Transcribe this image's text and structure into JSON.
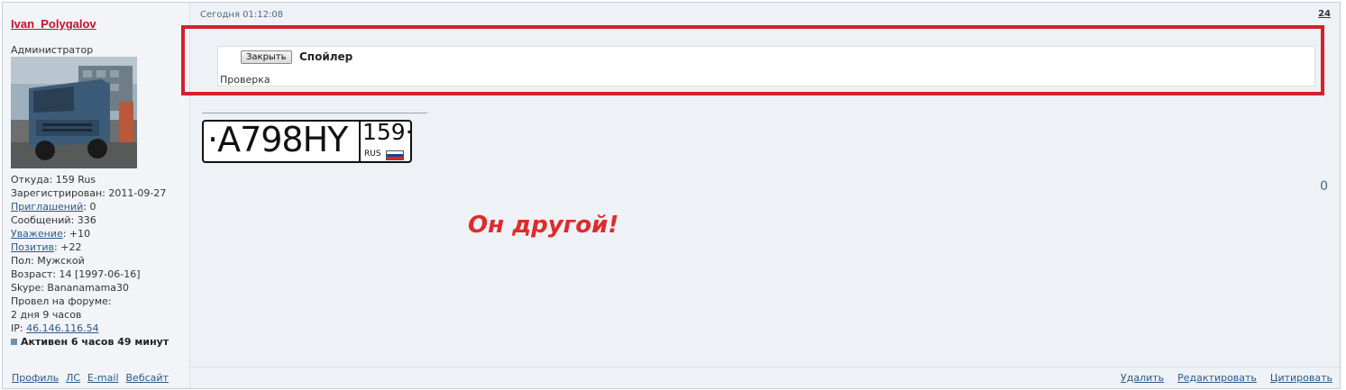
{
  "author": {
    "name": "Ivan_Polygalov",
    "rank": "Администратор",
    "profile": {
      "from": "Откуда: 159 Rus",
      "registered": "Зарегистрирован: 2011-09-27",
      "invites_label": "Приглашений",
      "invites_value": ": 0",
      "messages": "Сообщений: 336",
      "respect_label": "Уважение",
      "respect_value": ": +10",
      "positive_label": "Позитив",
      "positive_value": ": +22",
      "gender": "Пол: Мужской",
      "age": "Возраст: 14 [1997-06-16]",
      "skype": "Skype: Bananamama30",
      "forum_time_label": "Провел на форуме:",
      "forum_time_value": "2 дня 9 часов",
      "ip_label": "IP: ",
      "ip_value": "46.146.116.54",
      "online": "Активен 6 часов 49 минут"
    },
    "links": [
      "Профиль",
      "ЛС",
      "E-mail",
      "Вебсайт"
    ]
  },
  "post": {
    "date": "Сегодня 01:12:08",
    "number": "24",
    "spoiler": {
      "button_label": "Закрыть",
      "title": "Спойлер",
      "body": "Проверка"
    },
    "plate": {
      "main": "·A798HY",
      "region": "159·",
      "country": "RUS"
    },
    "rating": "0",
    "annotation": "Он другой!",
    "actions": [
      "Удалить",
      "Редактировать",
      "Цитировать"
    ]
  },
  "colors": {
    "accent_red": "#d6202a",
    "link_blue": "#2a5a8c",
    "annotation_red": "#e02a2a"
  }
}
